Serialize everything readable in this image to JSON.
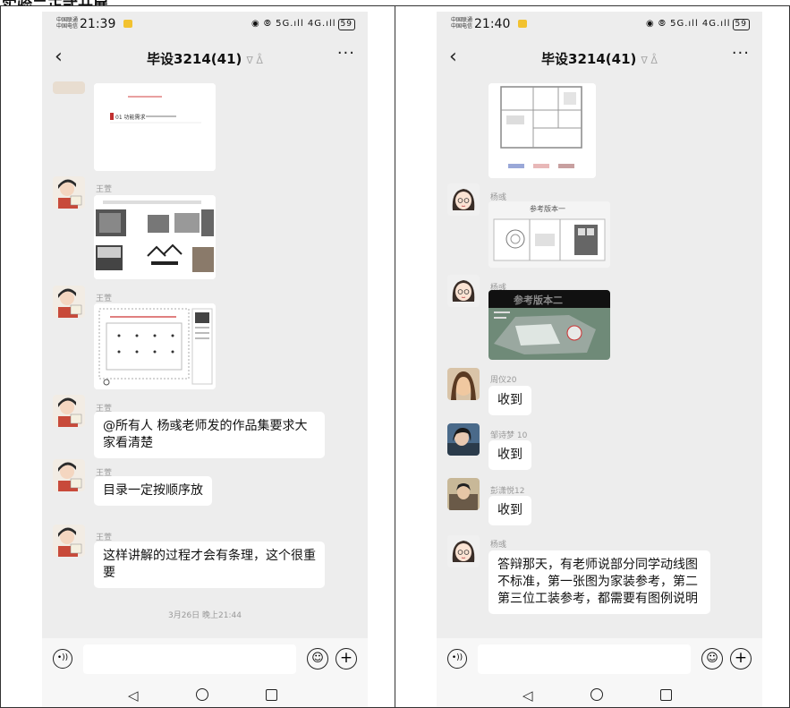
{
  "caption": "实验二正式开展",
  "left": {
    "status": {
      "carrier1": "中国联通",
      "carrier2": "中国电信",
      "time": "21:39",
      "signal": "◉ ⦾ 5G.ıll 4G.ıll",
      "battery": "59"
    },
    "chat_title": "毕设3214(41)",
    "messages": [
      {
        "sender": "王萱"
      },
      {
        "sender": "王萱"
      },
      {
        "sender": "王萱",
        "text": "@所有人  杨彧老师发的作品集要求大家看清楚"
      },
      {
        "sender": "王萱",
        "text": "目录一定按顺序放"
      },
      {
        "sender": "王萱",
        "text": "这样讲解的过程才会有条理，这个很重要"
      }
    ],
    "timestamp": "3月26日 晚上21:44",
    "image_text": {
      "catalog": "01 功能需求",
      "ref1": "参考版本一",
      "ref2": "参考版本二"
    }
  },
  "right": {
    "status": {
      "carrier1": "中国联通",
      "carrier2": "中国电信",
      "time": "21:40",
      "signal": "◉ ⦾ 5G.ıll 4G.ıll",
      "battery": "59"
    },
    "chat_title": "毕设3214(41)",
    "messages": [
      {
        "sender": "杨彧"
      },
      {
        "sender": "杨彧"
      },
      {
        "sender": "周仪20",
        "text": "收到"
      },
      {
        "sender": "邹诗梦 10",
        "text": "收到"
      },
      {
        "sender": "彭潇悦12",
        "text": "收到"
      },
      {
        "sender": "杨彧",
        "text": "答辩那天，有老师说部分同学动线图不标准，第一张图为家装参考，第二第三位工装参考，都需要有图例说明"
      }
    ]
  },
  "icons": {
    "back": "‹",
    "more": "···",
    "voice": "•))",
    "emoji": "☺",
    "plus": "+",
    "nav_back": "◁"
  }
}
